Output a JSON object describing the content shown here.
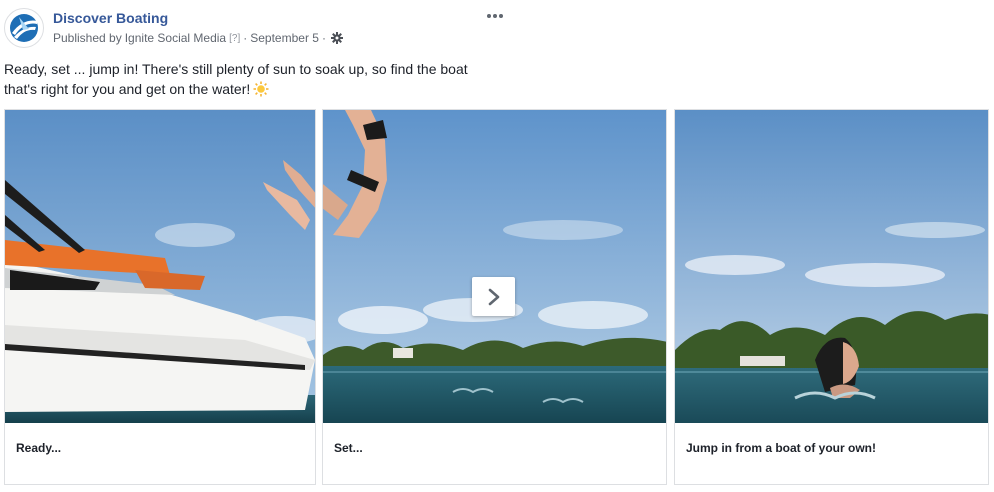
{
  "post": {
    "page_name": "Discover Boating",
    "published_by_prefix": "Published by",
    "publisher": "Ignite Social Media",
    "help_marker": "[?]",
    "separator": "·",
    "date": "September 5",
    "text_line1": "Ready, set ... jump in! There's still plenty of sun to soak up, so find the boat",
    "text_line2": "that's right for you and get on the water!"
  },
  "carousel": {
    "cards": [
      {
        "caption": "Ready..."
      },
      {
        "caption": "Set..."
      },
      {
        "caption": "Jump in from a boat of your own!"
      }
    ]
  },
  "icons": {
    "avatar": "discover-boating-logo",
    "options": "more-options-icon",
    "gear": "gear-icon",
    "next": "chevron-right-icon",
    "emoji": "sun-emoji"
  },
  "colors": {
    "link_blue": "#365899",
    "meta_gray": "#616770",
    "sky": "#5f92c8",
    "water": "#1f5565"
  }
}
